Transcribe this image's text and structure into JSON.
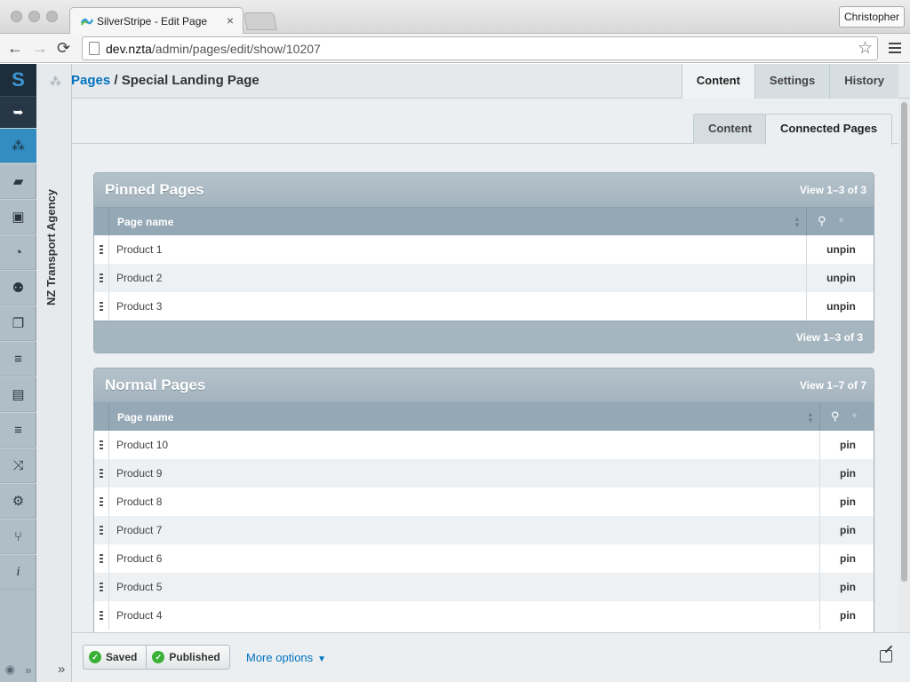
{
  "browser": {
    "tab_title": "SilverStripe - Edit Page",
    "tab_close": "×",
    "user_button": "Christopher",
    "url_host": "dev.nzta",
    "url_path": "/admin/pages/edit/show/10207",
    "back": "←",
    "forward": "→",
    "reload": "⟳",
    "star": "☆"
  },
  "cms_menu": {
    "logo": "S",
    "logout_icon": "logout-icon",
    "items": [
      {
        "icon": "sitetree-icon",
        "glyph": "⁂",
        "active": true
      },
      {
        "icon": "comments-icon",
        "glyph": "▰",
        "active": false
      },
      {
        "icon": "image-icon",
        "glyph": "▣",
        "active": false
      },
      {
        "icon": "piechart-icon",
        "glyph": "◔",
        "active": false
      },
      {
        "icon": "users-icon",
        "glyph": "⚉",
        "active": false
      },
      {
        "icon": "boxes-icon",
        "glyph": "❐",
        "active": false
      },
      {
        "icon": "database-icon",
        "glyph": "≡",
        "active": false
      },
      {
        "icon": "clipboard-icon",
        "glyph": "▤",
        "active": false
      },
      {
        "icon": "database2-icon",
        "glyph": "≡",
        "active": false
      },
      {
        "icon": "shuffle-icon",
        "glyph": "⤨",
        "active": false
      },
      {
        "icon": "gears-icon",
        "glyph": "⚙",
        "active": false
      },
      {
        "icon": "usb-icon",
        "glyph": "⑂",
        "active": false
      },
      {
        "icon": "info-icon",
        "glyph": "i",
        "active": false
      }
    ],
    "bottom_left": "◉",
    "bottom_right": "»"
  },
  "tree_panel": {
    "site_name": "NZ Transport Agency",
    "expand": "»"
  },
  "header": {
    "breadcrumb_link": "Pages",
    "breadcrumb_sep": " / ",
    "breadcrumb_current": "Special Landing Page",
    "tabs": [
      {
        "label": "Content",
        "active": true
      },
      {
        "label": "Settings",
        "active": false
      },
      {
        "label": "History",
        "active": false
      }
    ]
  },
  "subtabs": [
    {
      "label": "Content",
      "active": false
    },
    {
      "label": "Connected Pages",
      "active": true
    }
  ],
  "pinned": {
    "title": "Pinned Pages",
    "count_top": "View 1–3 of 3",
    "column": "Page name",
    "rows": [
      {
        "name": "Product 1",
        "action": "unpin"
      },
      {
        "name": "Product 2",
        "action": "unpin"
      },
      {
        "name": "Product 3",
        "action": "unpin"
      }
    ],
    "count_bottom": "View 1–3 of 3"
  },
  "normal": {
    "title": "Normal Pages",
    "count_top": "View 1–7 of 7",
    "column": "Page name",
    "rows": [
      {
        "name": "Product 10",
        "action": "pin"
      },
      {
        "name": "Product 9",
        "action": "pin"
      },
      {
        "name": "Product 8",
        "action": "pin"
      },
      {
        "name": "Product 7",
        "action": "pin"
      },
      {
        "name": "Product 6",
        "action": "pin"
      },
      {
        "name": "Product 5",
        "action": "pin"
      },
      {
        "name": "Product 4",
        "action": "pin"
      }
    ]
  },
  "actions": {
    "saved": "Saved",
    "published": "Published",
    "more_options": "More options"
  },
  "colors": {
    "accent": "#0073c1",
    "menu_active": "#338dc1",
    "grid_header": "#95a8b5",
    "success": "#3ab036"
  }
}
